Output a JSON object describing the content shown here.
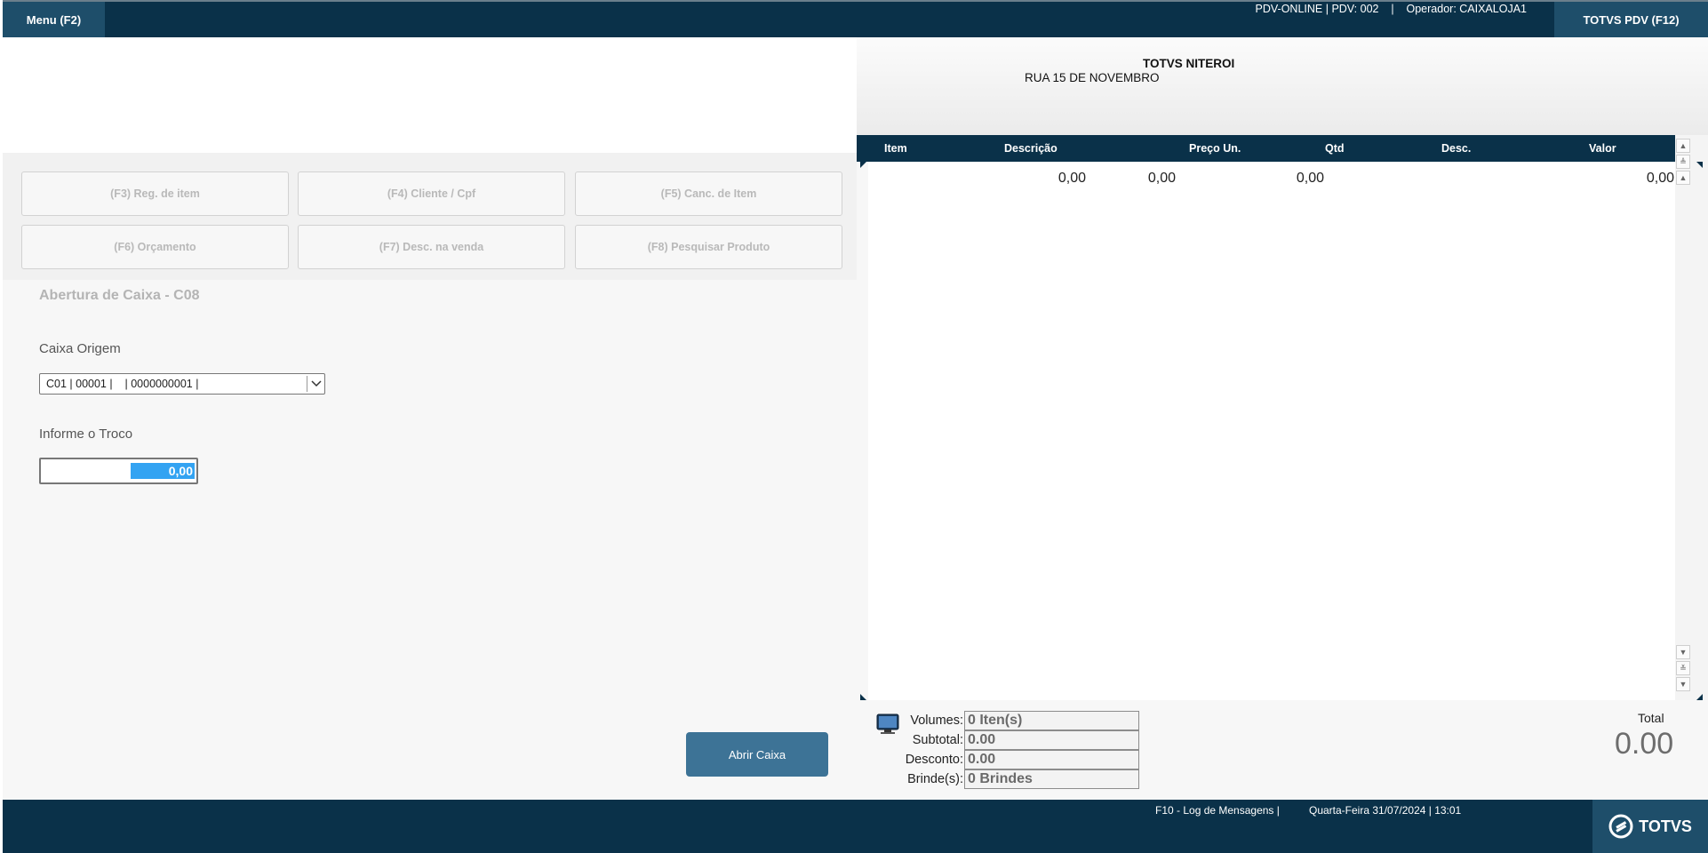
{
  "topbar": {
    "menu_label": "Menu (F2)",
    "pdv_info": "PDV-ONLINE | PDV: 002    |    Operador: CAIXALOJA1",
    "totvs_pdv_label": "TOTVS PDV (F12)"
  },
  "function_keys": [
    "(F3) Reg. de item",
    "(F4) Cliente / Cpf",
    "(F5) Canc. de Item",
    "(F6) Orçamento",
    "(F7) Desc. na venda",
    "(F8) Pesquisar Produto"
  ],
  "form": {
    "title": "Abertura de Caixa - C08",
    "caixa_origem_label": "Caixa Origem",
    "caixa_origem_value": "C01 | 00001 |    | 0000000001 |",
    "troco_label": "Informe o Troco",
    "troco_value": "0,00",
    "abrir_button": "Abrir Caixa"
  },
  "store": {
    "name": "TOTVS NITEROI",
    "address": "RUA 15 DE NOVEMBRO"
  },
  "items_table": {
    "columns": [
      "Item",
      "Descrição",
      "Preço Un.",
      "Qtd",
      "Desc.",
      "Valor"
    ],
    "rows": [
      {
        "item": "",
        "descricao": "",
        "preco": "0,00",
        "qtd": "0,00",
        "desc": "0,00",
        "valor": "0,00"
      }
    ]
  },
  "summary": {
    "volumes_label": "Volumes:",
    "volumes_value": "0 Iten(s)",
    "subtotal_label": "Subtotal:",
    "subtotal_value": "0.00",
    "desconto_label": "Desconto:",
    "desconto_value": "0.00",
    "brindes_label": "Brinde(s):",
    "brindes_value": "0 Brindes",
    "total_label": "Total",
    "total_value": "0.00"
  },
  "statusbar": {
    "log_label": "F10 - Log de Mensagens |",
    "datetime": "Quarta-Feira 31/07/2024 | 13:01",
    "logo_text": "TOTVS"
  },
  "colors": {
    "navy": "#0a3149",
    "button_blue": "#3d7396",
    "selection_blue": "#33a3f2"
  }
}
